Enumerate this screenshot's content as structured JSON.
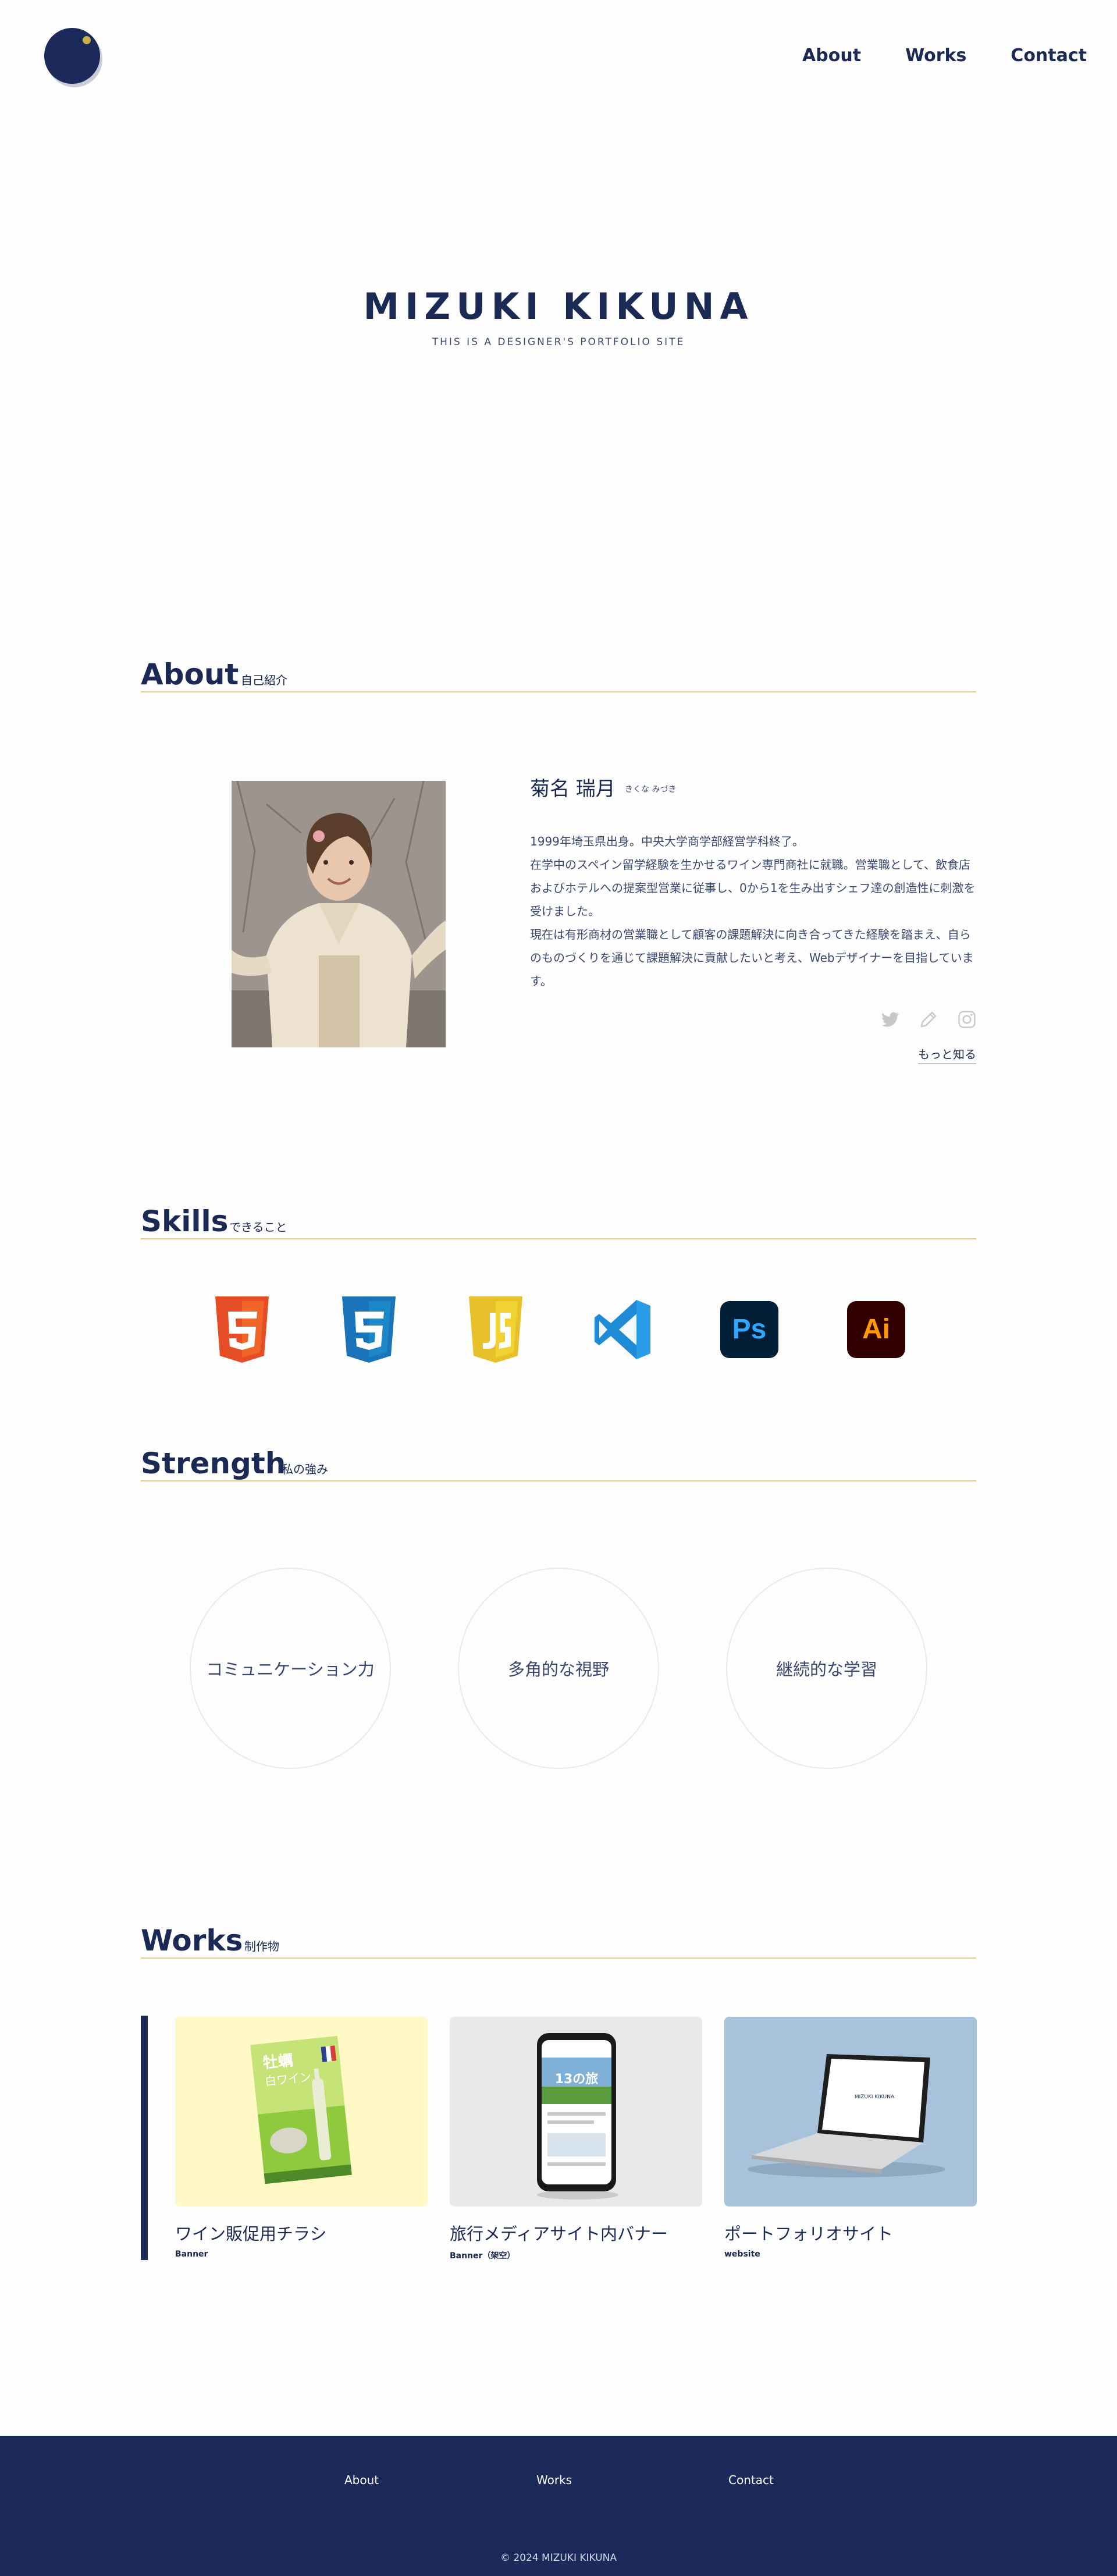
{
  "header": {
    "nav": [
      {
        "label": "About"
      },
      {
        "label": "Works"
      },
      {
        "label": "Contact"
      }
    ]
  },
  "hero": {
    "title": "MIZUKI KIKUNA",
    "subtitle": "THIS IS A DESIGNER'S PORTFOLIO SITE"
  },
  "about": {
    "heading": "About",
    "heading_sub": "自己紹介",
    "name": "菊名 瑞月",
    "name_kana": "きくな みづき",
    "paragraphs": [
      "1999年埼玉県出身。中央大学商学部経営学科終了。",
      "在学中のスペイン留学経験を生かせるワイン専門商社に就職。営業職として、飲食店およびホテルへの提案型営業に従事し、0から1を生み出すシェフ達の創造性に刺激を受けました。",
      "現在は有形商材の営業職として顧客の課題解決に向き合ってきた経験を踏まえ、自らのものづくりを通じて課題解決に貢献したいと考え、Webデザイナーを目指しています。"
    ],
    "more_label": "もっと知る",
    "social_icons": [
      "twitter-icon",
      "pencil-icon",
      "instagram-icon"
    ]
  },
  "skills": {
    "heading": "Skills",
    "heading_sub": "できること",
    "items": [
      {
        "icon": "html5-icon",
        "color": "#e44d26"
      },
      {
        "icon": "css3-icon",
        "color": "#1b73ba"
      },
      {
        "icon": "javascript-icon",
        "color": "#f0d232"
      },
      {
        "icon": "vscode-icon",
        "color": "#1f8ad6"
      },
      {
        "icon": "photoshop-icon",
        "color": "#31a8ff",
        "text": "Ps"
      },
      {
        "icon": "illustrator-icon",
        "color": "#ff9a00",
        "text": "Ai"
      }
    ]
  },
  "strength": {
    "heading": "Strength",
    "heading_sub": "私の強み",
    "items": [
      {
        "label": "コミュニケーション力"
      },
      {
        "label": "多角的な視野"
      },
      {
        "label": "継続的な学習"
      }
    ]
  },
  "works": {
    "heading": "Works",
    "heading_sub": "制作物",
    "items": [
      {
        "title": "ワイン販促用チラシ",
        "tag": "Banner",
        "flyer_text": "牡蠣",
        "flyer_text2": "白ワイン"
      },
      {
        "title": "旅行メディアサイト内バナー",
        "tag": "Banner（架空）",
        "phone_text": "13の旅"
      },
      {
        "title": "ポートフォリオサイト",
        "tag": "website",
        "laptop_text": "MIZUKI KIKUNA"
      }
    ]
  },
  "footer": {
    "nav": [
      {
        "label": "About"
      },
      {
        "label": "Works"
      },
      {
        "label": "Contact"
      }
    ],
    "copyright": "© 2024 MIZUKI KIKUNA",
    "background": "#1b2a5a"
  },
  "colors": {
    "navy": "#1b2a55",
    "accent_gold": "#e3cf8d"
  }
}
